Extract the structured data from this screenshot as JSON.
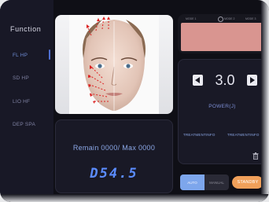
{
  "sidebar": {
    "title": "Function",
    "items": [
      {
        "label": "FL HP",
        "active": true
      },
      {
        "label": "SD HP",
        "active": false
      },
      {
        "label": "LIO HF",
        "active": false
      },
      {
        "label": "DEP SPA",
        "active": false
      }
    ]
  },
  "stats": {
    "remain_text": "Remain 0000/ Max 0000",
    "code": "D54.5"
  },
  "screen": {
    "modes": [
      "MODE 1",
      "MODE 2",
      "MODE 3"
    ]
  },
  "power": {
    "value": "3.0",
    "label": "POWER(J)",
    "info_left": "TREATMENTINFO",
    "info_right": "TREATMENTINFO"
  },
  "controls": {
    "auto_label": "AUTO",
    "manual_label": "MANUAL",
    "standby_label": "STANDBY"
  },
  "colors": {
    "accent": "#4f6fd1",
    "screen": "#d99590",
    "standby": "#f0a05a",
    "auto": "#7da6ec"
  }
}
